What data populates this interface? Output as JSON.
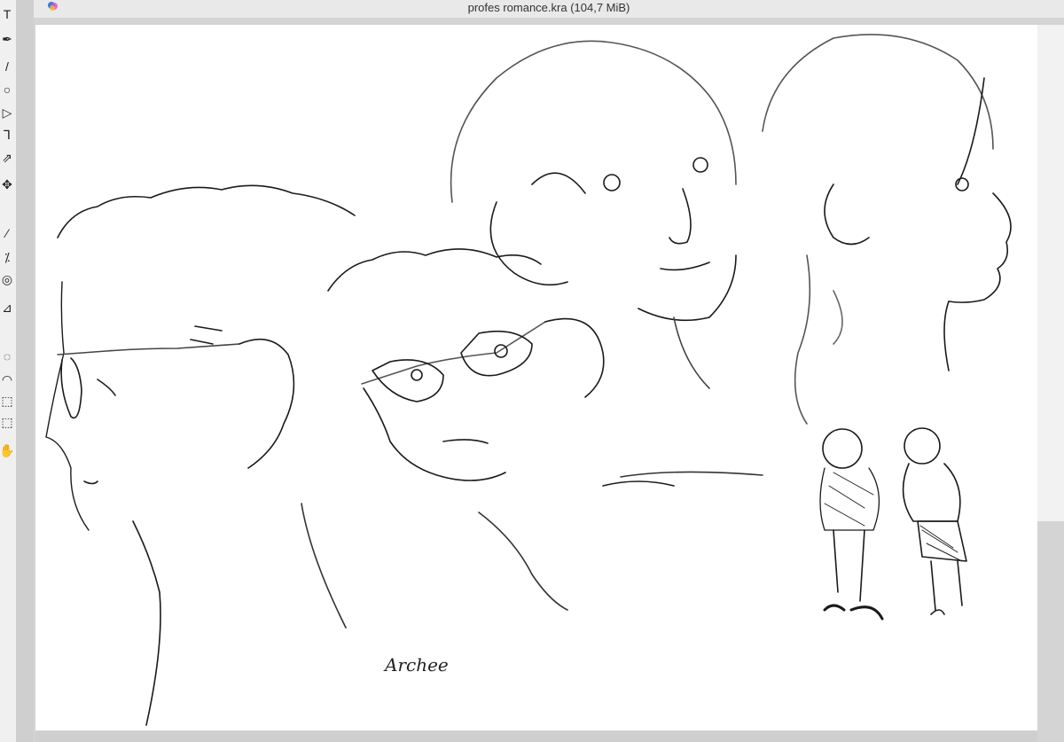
{
  "window": {
    "title": "profes romance.kra (104,7 MiB)"
  },
  "canvas": {
    "signature": "Archee"
  },
  "tools": [
    {
      "name": "text-tool-icon",
      "glyph": "T"
    },
    {
      "name": "calligraphy-tool-icon",
      "glyph": "✒"
    },
    {
      "name": "line-tool-icon",
      "glyph": "/"
    },
    {
      "name": "ellipse-tool-icon",
      "glyph": "○"
    },
    {
      "name": "polygon-tool-icon",
      "glyph": "▷"
    },
    {
      "name": "bezier-tool-icon",
      "glyph": "Ꞁ"
    },
    {
      "name": "dynamic-brush-tool-icon",
      "glyph": "⇗"
    },
    {
      "name": "move-tool-icon",
      "glyph": "✥"
    },
    {
      "name": "color-picker-icon",
      "glyph": "⁄"
    },
    {
      "name": "gradient-tool-icon",
      "glyph": "⁒"
    },
    {
      "name": "smart-patch-icon",
      "glyph": "◎"
    },
    {
      "name": "measure-tool-icon",
      "glyph": "⊿"
    },
    {
      "name": "elliptical-select-icon",
      "glyph": "◌"
    },
    {
      "name": "freehand-select-icon",
      "glyph": "◠"
    },
    {
      "name": "contiguous-select-icon",
      "glyph": "⬚"
    },
    {
      "name": "similar-select-icon",
      "glyph": "⬚"
    },
    {
      "name": "pan-tool-icon",
      "glyph": "✋"
    }
  ],
  "colors": {
    "toolbox_bg": "#f0f0f0",
    "canvas_bg": "#ffffff",
    "workspace_bg": "#d4d4d4",
    "ink": "#1a1a1a"
  }
}
